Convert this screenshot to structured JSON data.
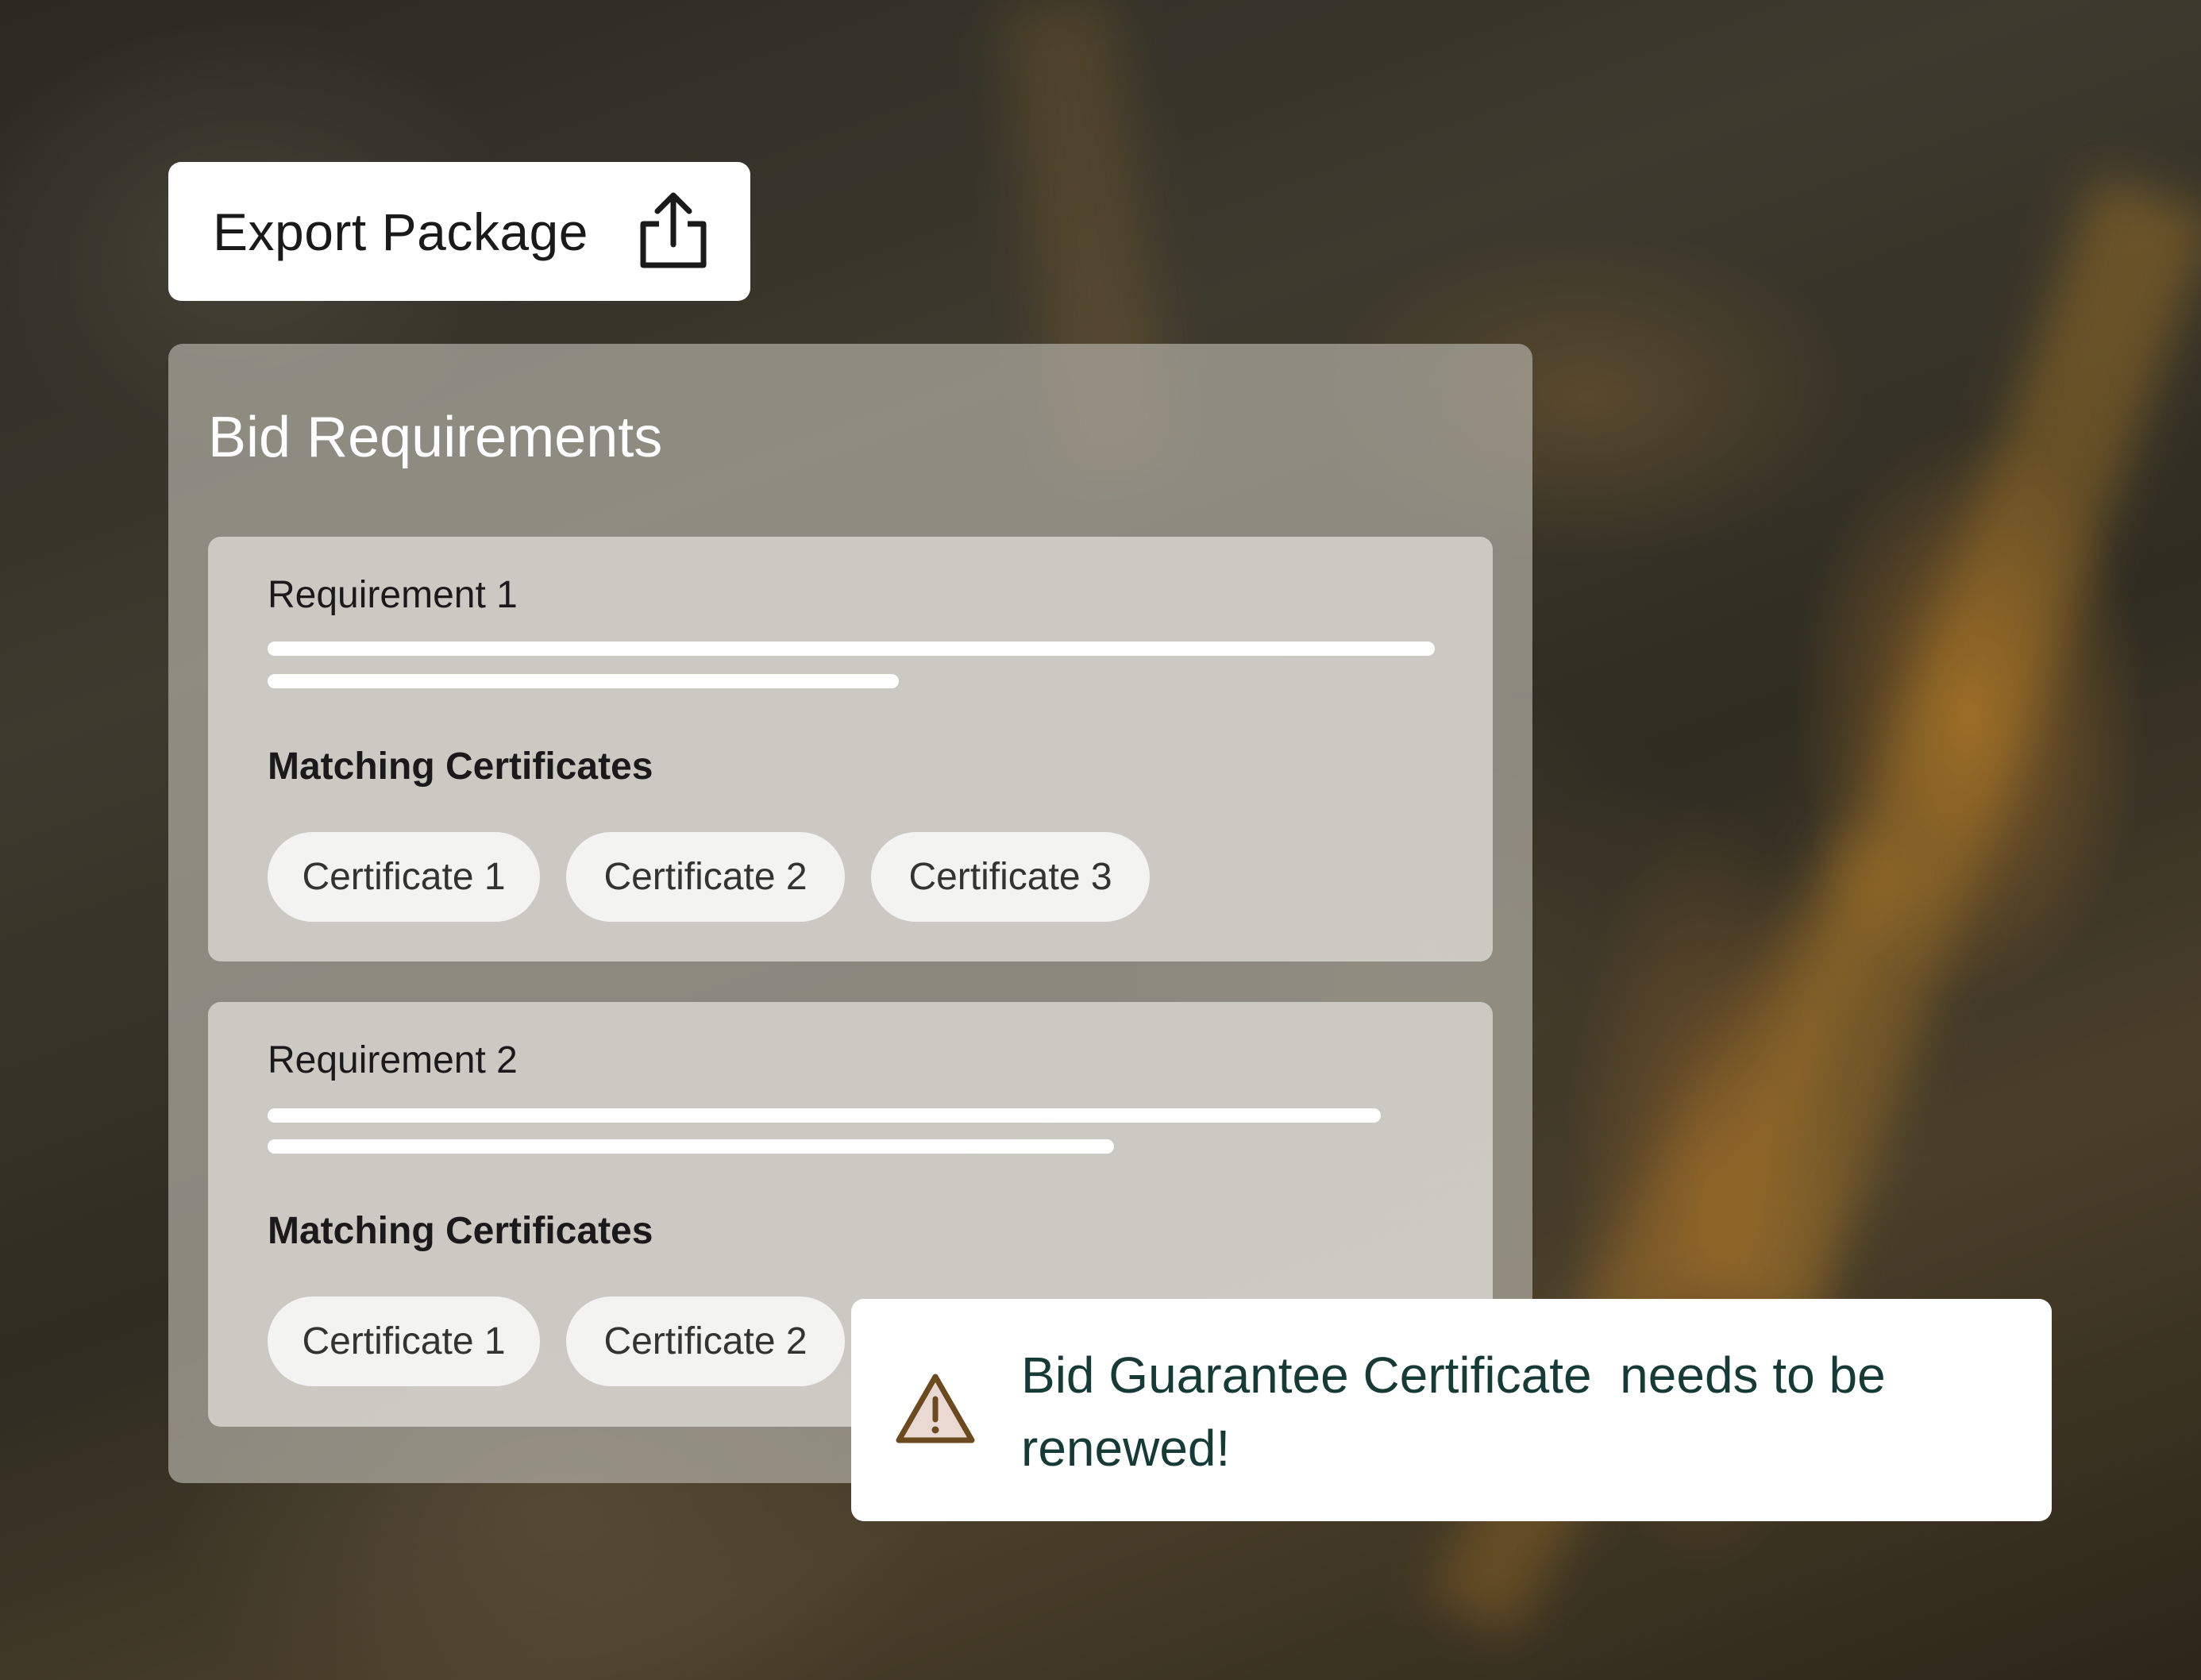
{
  "toolbar": {
    "export_label": "Export Package"
  },
  "panel": {
    "title": "Bid Requirements",
    "requirements": [
      {
        "title": "Requirement 1",
        "matching_label": "Matching Certificates",
        "certificates": [
          "Certificate 1",
          "Certificate 2",
          "Certificate 3"
        ]
      },
      {
        "title": "Requirement 2",
        "matching_label": "Matching Certificates",
        "certificates": [
          "Certificate 1",
          "Certificate 2"
        ]
      }
    ]
  },
  "alert": {
    "message": "Bid Guarantee Certificate  needs to be renewed!"
  },
  "colors": {
    "alert_text": "#163a36",
    "warning_icon": "#6b4a20",
    "warning_fill": "#ead9d3"
  },
  "icons": {
    "export": "share-upload-icon",
    "alert": "warning-triangle-icon"
  }
}
